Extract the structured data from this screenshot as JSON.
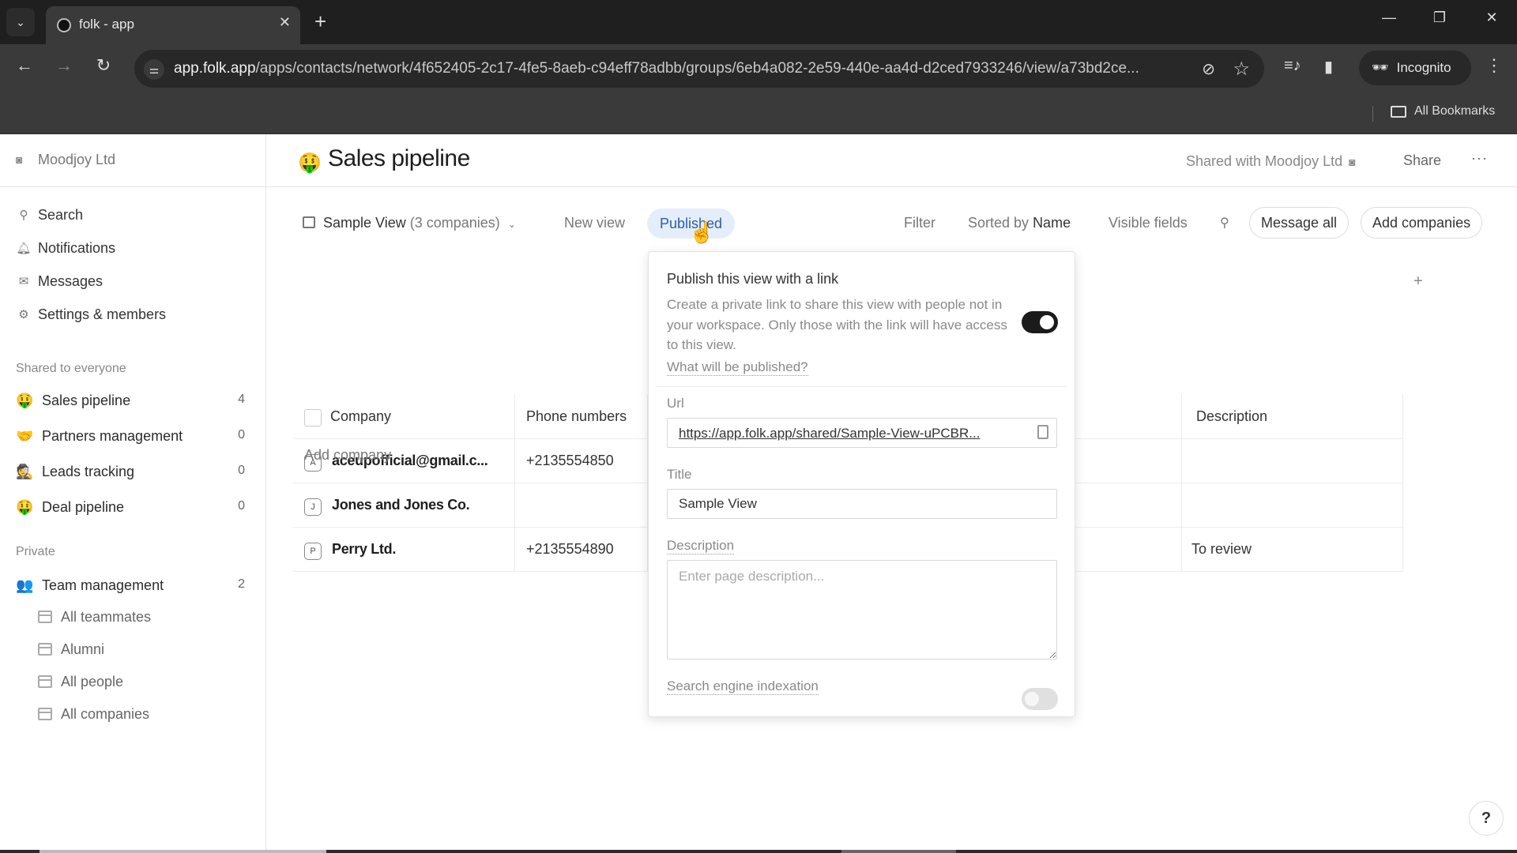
{
  "browser": {
    "tab_title": "folk - app",
    "url_host": "app.folk.app",
    "url_path": "/apps/contacts/network/4f652405-2c17-4fe5-8aeb-c94eff78adbb/groups/6eb4a082-2e59-440e-aa4d-d2ced7933246/view/a73bd2ce...",
    "incognito_label": "Incognito",
    "bookmarks_label": "All Bookmarks"
  },
  "sidebar": {
    "workspace_name": "Moodjoy Ltd",
    "nav": [
      {
        "label": "Search",
        "icon": "search-icon"
      },
      {
        "label": "Notifications",
        "icon": "bell-icon"
      },
      {
        "label": "Messages",
        "icon": "mail-icon"
      },
      {
        "label": "Settings & members",
        "icon": "gear-icon"
      }
    ],
    "shared_section_title": "Shared to everyone",
    "shared_groups": [
      {
        "label": "Sales pipeline",
        "count": "4",
        "emoji": "🤑"
      },
      {
        "label": "Partners management",
        "count": "0",
        "emoji": "🤝"
      },
      {
        "label": "Leads tracking",
        "count": "0",
        "emoji": "🕵"
      },
      {
        "label": "Deal pipeline",
        "count": "0",
        "emoji": "🤑"
      }
    ],
    "private_section_title": "Private",
    "private_groups": [
      {
        "label": "Team management",
        "count": "2",
        "emoji": "👥"
      }
    ],
    "private_views": [
      {
        "label": "All teammates"
      },
      {
        "label": "Alumni"
      },
      {
        "label": "All people"
      },
      {
        "label": "All companies"
      }
    ]
  },
  "header": {
    "emoji": "🤑",
    "title": "Sales pipeline",
    "shared_with": "Shared with Moodjoy Ltd",
    "share_label": "Share",
    "more_label": "···"
  },
  "view_bar": {
    "view_name": "Sample View",
    "view_count": "(3 companies)",
    "new_view": "New view",
    "published": "Published",
    "filter": "Filter",
    "sorted_prefix": "Sorted by",
    "sorted_field": "Name",
    "visible_fields": "Visible fields",
    "message_all": "Message all",
    "add_companies": "Add companies"
  },
  "table": {
    "columns": [
      "Company",
      "Phone numbers",
      "Description"
    ],
    "rows": [
      {
        "initial": "A",
        "company": "aceupofficial@gmail.c...",
        "phone": "+2135554850",
        "description": ""
      },
      {
        "initial": "J",
        "company": "Jones and Jones Co.",
        "phone": "",
        "description": ""
      },
      {
        "initial": "P",
        "company": "Perry Ltd.",
        "phone": "+2135554890",
        "description": "To review"
      }
    ],
    "add_company": "Add company",
    "add_column": "+"
  },
  "publish_popover": {
    "title": "Publish this view with a link",
    "description": "Create a private link to share this view with people not in your workspace. Only those with the link will have access to this view.",
    "what_link": "What will be published?",
    "publish_enabled": true,
    "url_label": "Url",
    "url_value": "https://app.folk.app/shared/Sample-View-uPCBR...",
    "title_label": "Title",
    "title_value": "Sample View",
    "description_label": "Description",
    "description_placeholder": "Enter page description...",
    "description_value": "",
    "indexation_label": "Search engine indexation",
    "indexation_enabled": false
  },
  "help_label": "?"
}
